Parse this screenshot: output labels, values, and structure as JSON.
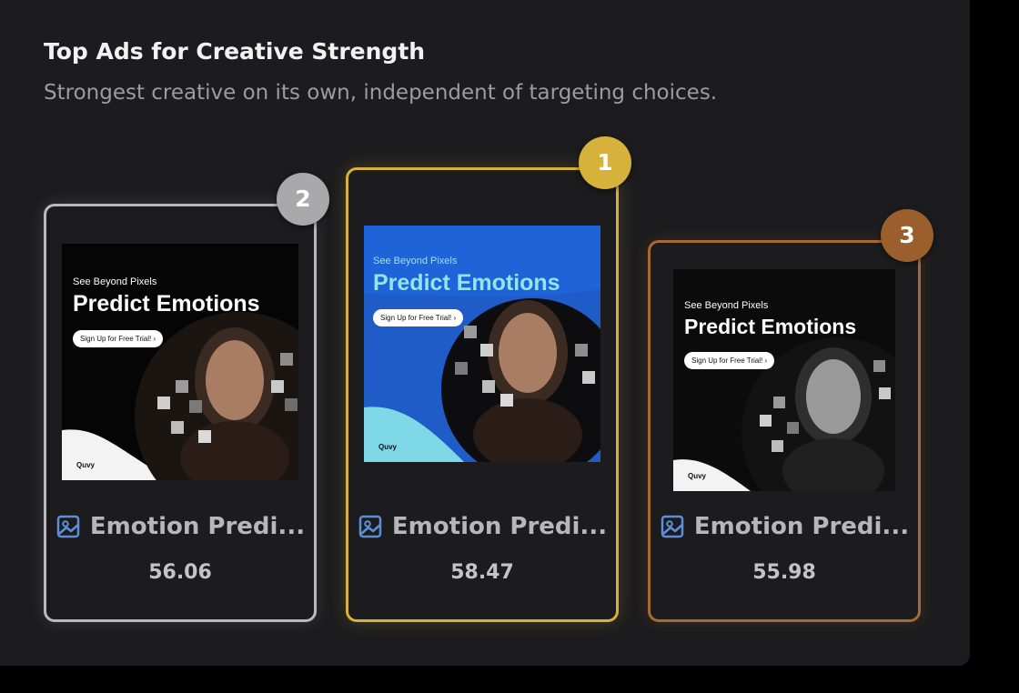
{
  "section": {
    "title": "Top Ads for Creative Strength",
    "subtitle": "Strongest creative on its own, independent of targeting choices."
  },
  "colors": {
    "gold": "#d6b23c",
    "silver": "#b9b9bc",
    "bronze": "#a86a34",
    "panel": "#1c1c1e"
  },
  "cards": [
    {
      "rank": "2",
      "name": "Emotion Predi...",
      "score": "56.06",
      "icon": "image-icon",
      "ad": {
        "kicker": "See Beyond Pixels",
        "headline": "Predict Emotions",
        "cta": "Sign Up for Free Trial!",
        "brand": "Quvy",
        "theme": "black"
      }
    },
    {
      "rank": "1",
      "name": "Emotion Predi...",
      "score": "58.47",
      "icon": "image-icon",
      "ad": {
        "kicker": "See Beyond Pixels",
        "headline": "Predict Emotions",
        "cta": "Sign Up for Free Trial!",
        "brand": "Quvy",
        "theme": "blue"
      }
    },
    {
      "rank": "3",
      "name": "Emotion Predi...",
      "score": "55.98",
      "icon": "image-icon",
      "ad": {
        "kicker": "See Beyond Pixels",
        "headline": "Predict Emotions",
        "cta": "Sign Up for Free Trial!",
        "brand": "Quvy",
        "theme": "black-and-white"
      }
    }
  ]
}
